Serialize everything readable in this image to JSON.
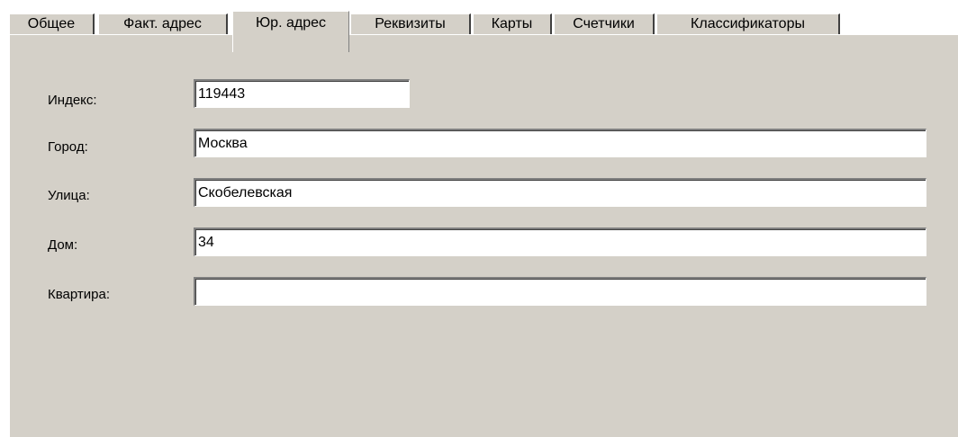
{
  "tabs": [
    {
      "label": "Общее",
      "active": false
    },
    {
      "label": "Факт. адрес",
      "active": false
    },
    {
      "label": "Юр. адрес",
      "active": true
    },
    {
      "label": "Реквизиты",
      "active": false
    },
    {
      "label": "Карты",
      "active": false
    },
    {
      "label": "Счетчики",
      "active": false
    },
    {
      "label": "Классификаторы",
      "active": false
    }
  ],
  "form": {
    "index": {
      "label": "Индекс:",
      "value": "119443"
    },
    "city": {
      "label": "Город:",
      "value": "Москва"
    },
    "street": {
      "label": "Улица:",
      "value": "Скобелевская"
    },
    "house": {
      "label": "Дом:",
      "value": "34"
    },
    "apartment": {
      "label": "Квартира:",
      "value": ""
    }
  },
  "colors": {
    "face": "#d4d0c8",
    "highlight": "#ffffff",
    "shadow": "#808080",
    "dark_shadow": "#404040"
  }
}
